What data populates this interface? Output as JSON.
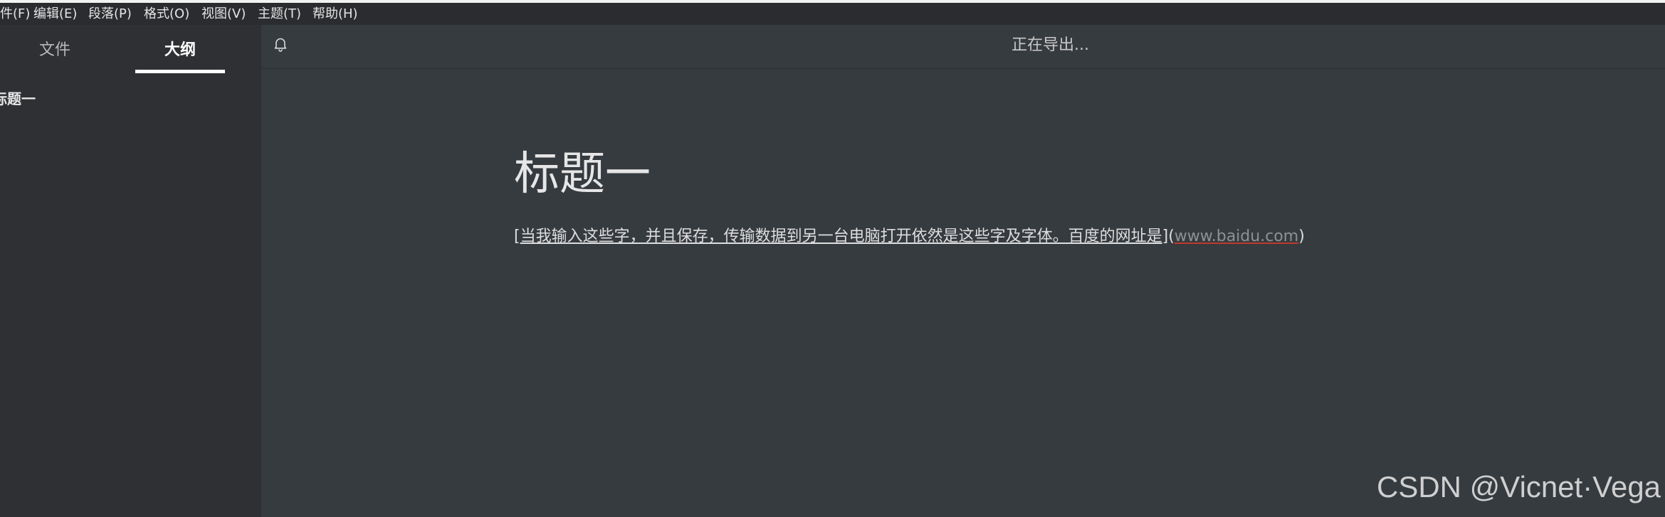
{
  "menubar": {
    "items": [
      {
        "label": "件(F)"
      },
      {
        "label": "编辑(E)"
      },
      {
        "label": "段落(P)"
      },
      {
        "label": "格式(O)"
      },
      {
        "label": "视图(V)"
      },
      {
        "label": "主题(T)"
      },
      {
        "label": "帮助(H)"
      }
    ]
  },
  "sidebar": {
    "tabs": [
      {
        "label": "文件",
        "active": false
      },
      {
        "label": "大纲",
        "active": true
      }
    ],
    "outline": [
      {
        "label": "标题一"
      }
    ]
  },
  "header": {
    "status": "正在导出..."
  },
  "document": {
    "heading": "标题一",
    "paragraph": {
      "open_bracket": "[",
      "link_text": "当我输入这些字，并且保存，传输数据到另一台电脑打开依然是这些字及字体。百度的网址是",
      "close_bracket_paren": "](",
      "url": "www.baidu.com",
      "close_paren": ")"
    }
  },
  "watermark": {
    "text": "CSDN @Vicnet·Vega"
  },
  "icons": {
    "notification": "bell-icon"
  },
  "colors": {
    "editor_bg": "#363B40",
    "sidebar_bg": "#2e3033",
    "menubar_bg": "#2b2c30",
    "url_underline": "#c0392b"
  }
}
